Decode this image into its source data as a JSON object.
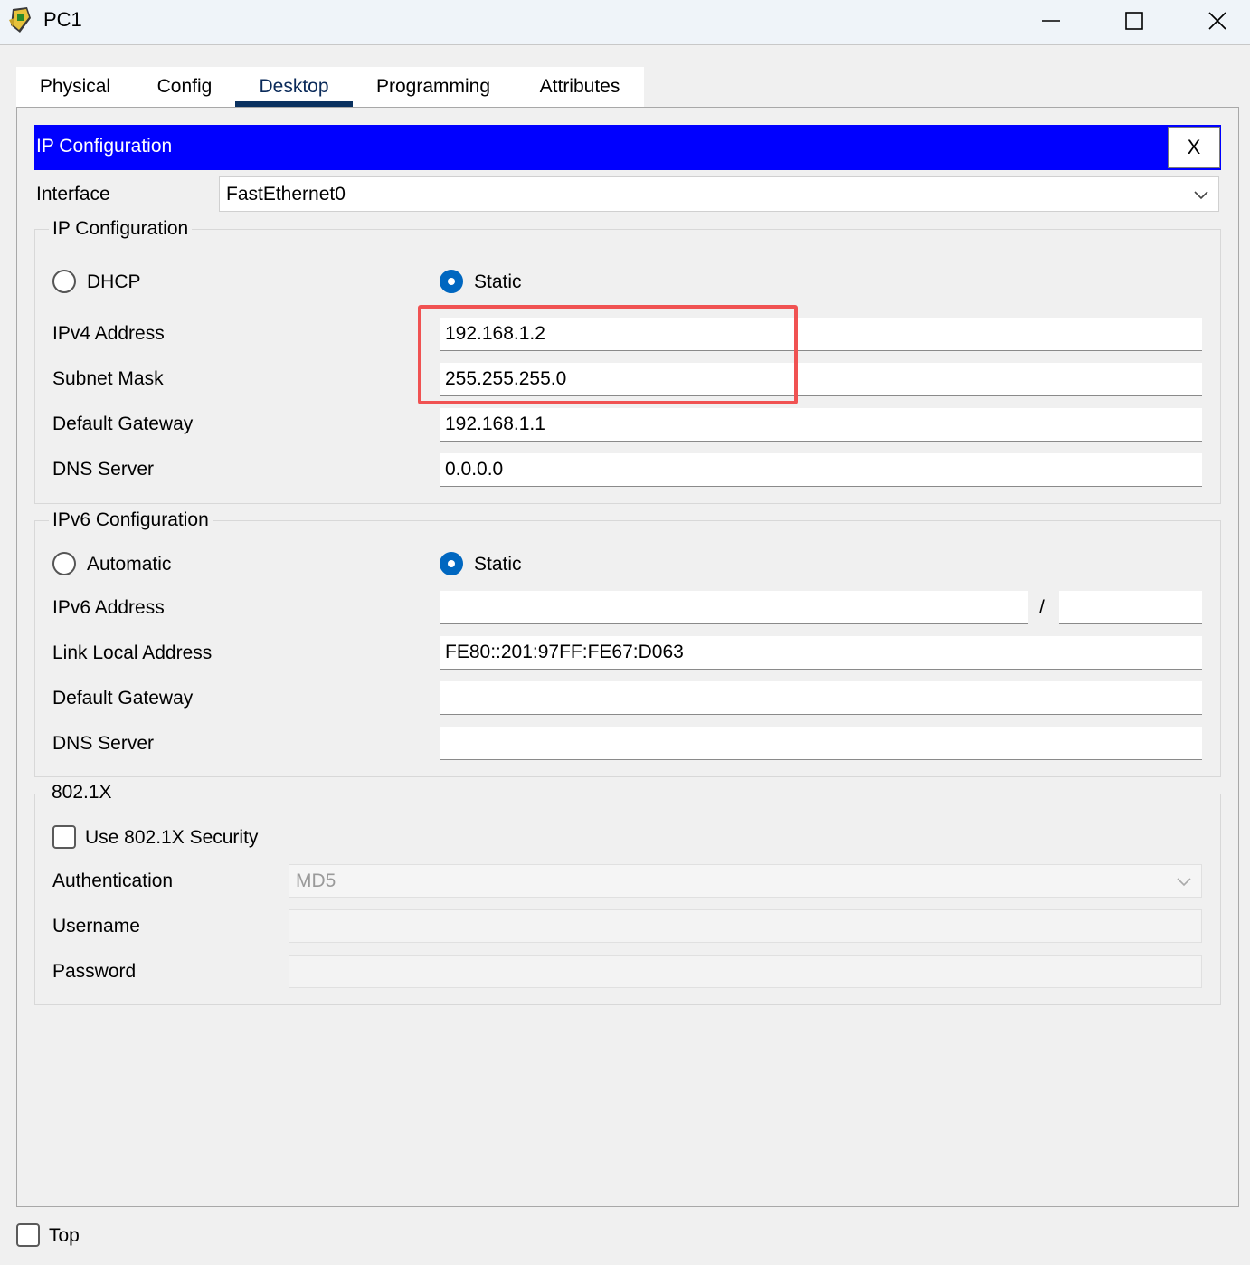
{
  "window": {
    "title": "PC1",
    "app_icon": "packet-tracer-pc-icon",
    "controls": [
      "minimize-icon",
      "maximize-icon",
      "close-icon"
    ]
  },
  "tabs": [
    {
      "label": "Physical",
      "active": false
    },
    {
      "label": "Config",
      "active": false
    },
    {
      "label": "Desktop",
      "active": true
    },
    {
      "label": "Programming",
      "active": false
    },
    {
      "label": "Attributes",
      "active": false
    }
  ],
  "panel": {
    "title": "IP Configuration",
    "close_label": "X",
    "header_color": "#0000ff"
  },
  "interface": {
    "label": "Interface",
    "value": "FastEthernet0"
  },
  "ipv4": {
    "legend": "IP Configuration",
    "dhcp_label": "DHCP",
    "static_label": "Static",
    "selected": "Static",
    "address_label": "IPv4 Address",
    "address_value": "192.168.1.2",
    "mask_label": "Subnet Mask",
    "mask_value": "255.255.255.0",
    "gateway_label": "Default Gateway",
    "gateway_value": "192.168.1.1",
    "dns_label": "DNS Server",
    "dns_value": "0.0.0.0"
  },
  "ipv6": {
    "legend": "IPv6 Configuration",
    "auto_label": "Automatic",
    "static_label": "Static",
    "selected": "Static",
    "address_label": "IPv6 Address",
    "address_value": "",
    "prefix_separator": "/",
    "prefix_value": "",
    "link_local_label": "Link Local Address",
    "link_local_value": "FE80::201:97FF:FE67:D063",
    "gateway_label": "Default Gateway",
    "gateway_value": "",
    "dns_label": "DNS Server",
    "dns_value": ""
  },
  "dot1x": {
    "legend": "802.1X",
    "use_label": "Use 802.1X Security",
    "use_checked": false,
    "auth_label": "Authentication",
    "auth_value": "MD5",
    "username_label": "Username",
    "username_value": "",
    "password_label": "Password",
    "password_value": ""
  },
  "footer": {
    "top_label": "Top",
    "top_checked": false
  },
  "annotation": {
    "highlight_color": "#f05252"
  }
}
